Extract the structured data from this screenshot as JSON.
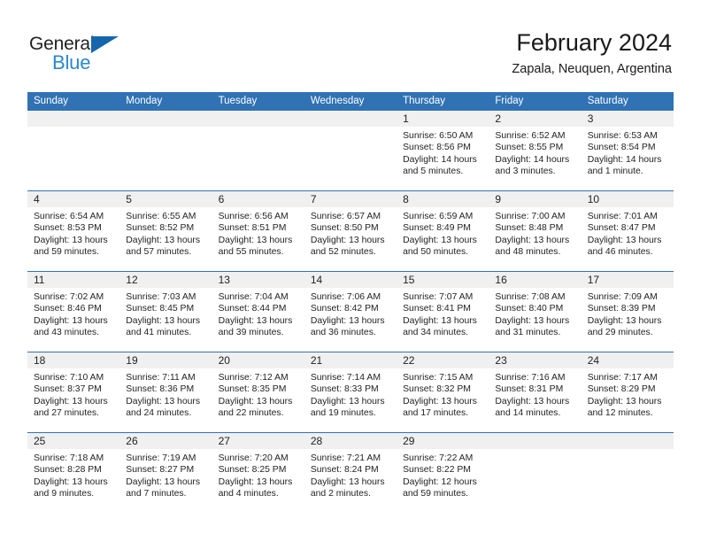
{
  "brand": {
    "name_top": "General",
    "name_bottom": "Blue",
    "triangle_color": "#1566ad",
    "blue_color": "#2a87d0"
  },
  "header": {
    "title": "February 2024",
    "subtitle": "Zapala, Neuquen, Argentina",
    "accent_color": "#3072b4",
    "band_color": "#f0f0f0"
  },
  "weekdays": [
    "Sunday",
    "Monday",
    "Tuesday",
    "Wednesday",
    "Thursday",
    "Friday",
    "Saturday"
  ],
  "weeks": [
    [
      {
        "day": "",
        "sunrise": "",
        "sunset": "",
        "daylight_1": "",
        "daylight_2": ""
      },
      {
        "day": "",
        "sunrise": "",
        "sunset": "",
        "daylight_1": "",
        "daylight_2": ""
      },
      {
        "day": "",
        "sunrise": "",
        "sunset": "",
        "daylight_1": "",
        "daylight_2": ""
      },
      {
        "day": "",
        "sunrise": "",
        "sunset": "",
        "daylight_1": "",
        "daylight_2": ""
      },
      {
        "day": "1",
        "sunrise": "Sunrise: 6:50 AM",
        "sunset": "Sunset: 8:56 PM",
        "daylight_1": "Daylight: 14 hours",
        "daylight_2": "and 5 minutes."
      },
      {
        "day": "2",
        "sunrise": "Sunrise: 6:52 AM",
        "sunset": "Sunset: 8:55 PM",
        "daylight_1": "Daylight: 14 hours",
        "daylight_2": "and 3 minutes."
      },
      {
        "day": "3",
        "sunrise": "Sunrise: 6:53 AM",
        "sunset": "Sunset: 8:54 PM",
        "daylight_1": "Daylight: 14 hours",
        "daylight_2": "and 1 minute."
      }
    ],
    [
      {
        "day": "4",
        "sunrise": "Sunrise: 6:54 AM",
        "sunset": "Sunset: 8:53 PM",
        "daylight_1": "Daylight: 13 hours",
        "daylight_2": "and 59 minutes."
      },
      {
        "day": "5",
        "sunrise": "Sunrise: 6:55 AM",
        "sunset": "Sunset: 8:52 PM",
        "daylight_1": "Daylight: 13 hours",
        "daylight_2": "and 57 minutes."
      },
      {
        "day": "6",
        "sunrise": "Sunrise: 6:56 AM",
        "sunset": "Sunset: 8:51 PM",
        "daylight_1": "Daylight: 13 hours",
        "daylight_2": "and 55 minutes."
      },
      {
        "day": "7",
        "sunrise": "Sunrise: 6:57 AM",
        "sunset": "Sunset: 8:50 PM",
        "daylight_1": "Daylight: 13 hours",
        "daylight_2": "and 52 minutes."
      },
      {
        "day": "8",
        "sunrise": "Sunrise: 6:59 AM",
        "sunset": "Sunset: 8:49 PM",
        "daylight_1": "Daylight: 13 hours",
        "daylight_2": "and 50 minutes."
      },
      {
        "day": "9",
        "sunrise": "Sunrise: 7:00 AM",
        "sunset": "Sunset: 8:48 PM",
        "daylight_1": "Daylight: 13 hours",
        "daylight_2": "and 48 minutes."
      },
      {
        "day": "10",
        "sunrise": "Sunrise: 7:01 AM",
        "sunset": "Sunset: 8:47 PM",
        "daylight_1": "Daylight: 13 hours",
        "daylight_2": "and 46 minutes."
      }
    ],
    [
      {
        "day": "11",
        "sunrise": "Sunrise: 7:02 AM",
        "sunset": "Sunset: 8:46 PM",
        "daylight_1": "Daylight: 13 hours",
        "daylight_2": "and 43 minutes."
      },
      {
        "day": "12",
        "sunrise": "Sunrise: 7:03 AM",
        "sunset": "Sunset: 8:45 PM",
        "daylight_1": "Daylight: 13 hours",
        "daylight_2": "and 41 minutes."
      },
      {
        "day": "13",
        "sunrise": "Sunrise: 7:04 AM",
        "sunset": "Sunset: 8:44 PM",
        "daylight_1": "Daylight: 13 hours",
        "daylight_2": "and 39 minutes."
      },
      {
        "day": "14",
        "sunrise": "Sunrise: 7:06 AM",
        "sunset": "Sunset: 8:42 PM",
        "daylight_1": "Daylight: 13 hours",
        "daylight_2": "and 36 minutes."
      },
      {
        "day": "15",
        "sunrise": "Sunrise: 7:07 AM",
        "sunset": "Sunset: 8:41 PM",
        "daylight_1": "Daylight: 13 hours",
        "daylight_2": "and 34 minutes."
      },
      {
        "day": "16",
        "sunrise": "Sunrise: 7:08 AM",
        "sunset": "Sunset: 8:40 PM",
        "daylight_1": "Daylight: 13 hours",
        "daylight_2": "and 31 minutes."
      },
      {
        "day": "17",
        "sunrise": "Sunrise: 7:09 AM",
        "sunset": "Sunset: 8:39 PM",
        "daylight_1": "Daylight: 13 hours",
        "daylight_2": "and 29 minutes."
      }
    ],
    [
      {
        "day": "18",
        "sunrise": "Sunrise: 7:10 AM",
        "sunset": "Sunset: 8:37 PM",
        "daylight_1": "Daylight: 13 hours",
        "daylight_2": "and 27 minutes."
      },
      {
        "day": "19",
        "sunrise": "Sunrise: 7:11 AM",
        "sunset": "Sunset: 8:36 PM",
        "daylight_1": "Daylight: 13 hours",
        "daylight_2": "and 24 minutes."
      },
      {
        "day": "20",
        "sunrise": "Sunrise: 7:12 AM",
        "sunset": "Sunset: 8:35 PM",
        "daylight_1": "Daylight: 13 hours",
        "daylight_2": "and 22 minutes."
      },
      {
        "day": "21",
        "sunrise": "Sunrise: 7:14 AM",
        "sunset": "Sunset: 8:33 PM",
        "daylight_1": "Daylight: 13 hours",
        "daylight_2": "and 19 minutes."
      },
      {
        "day": "22",
        "sunrise": "Sunrise: 7:15 AM",
        "sunset": "Sunset: 8:32 PM",
        "daylight_1": "Daylight: 13 hours",
        "daylight_2": "and 17 minutes."
      },
      {
        "day": "23",
        "sunrise": "Sunrise: 7:16 AM",
        "sunset": "Sunset: 8:31 PM",
        "daylight_1": "Daylight: 13 hours",
        "daylight_2": "and 14 minutes."
      },
      {
        "day": "24",
        "sunrise": "Sunrise: 7:17 AM",
        "sunset": "Sunset: 8:29 PM",
        "daylight_1": "Daylight: 13 hours",
        "daylight_2": "and 12 minutes."
      }
    ],
    [
      {
        "day": "25",
        "sunrise": "Sunrise: 7:18 AM",
        "sunset": "Sunset: 8:28 PM",
        "daylight_1": "Daylight: 13 hours",
        "daylight_2": "and 9 minutes."
      },
      {
        "day": "26",
        "sunrise": "Sunrise: 7:19 AM",
        "sunset": "Sunset: 8:27 PM",
        "daylight_1": "Daylight: 13 hours",
        "daylight_2": "and 7 minutes."
      },
      {
        "day": "27",
        "sunrise": "Sunrise: 7:20 AM",
        "sunset": "Sunset: 8:25 PM",
        "daylight_1": "Daylight: 13 hours",
        "daylight_2": "and 4 minutes."
      },
      {
        "day": "28",
        "sunrise": "Sunrise: 7:21 AM",
        "sunset": "Sunset: 8:24 PM",
        "daylight_1": "Daylight: 13 hours",
        "daylight_2": "and 2 minutes."
      },
      {
        "day": "29",
        "sunrise": "Sunrise: 7:22 AM",
        "sunset": "Sunset: 8:22 PM",
        "daylight_1": "Daylight: 12 hours",
        "daylight_2": "and 59 minutes."
      },
      {
        "day": "",
        "sunrise": "",
        "sunset": "",
        "daylight_1": "",
        "daylight_2": ""
      },
      {
        "day": "",
        "sunrise": "",
        "sunset": "",
        "daylight_1": "",
        "daylight_2": ""
      }
    ]
  ]
}
